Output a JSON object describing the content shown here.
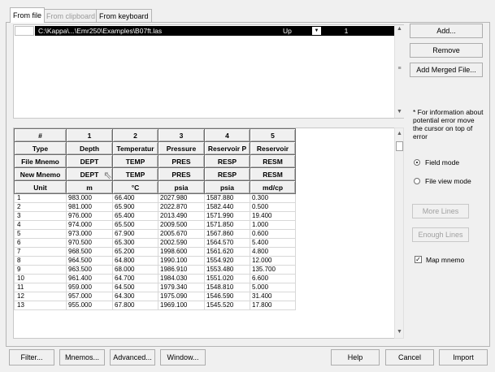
{
  "tabs": [
    "From file",
    "From clipboard",
    "From keyboard"
  ],
  "file_row": {
    "path": "C:\\Kappa\\...\\Emr250\\Examples\\B07ft.las",
    "direction": "Up",
    "count": "1"
  },
  "right_buttons": {
    "add": "Add...",
    "remove": "Remove",
    "add_merged": "Add Merged File..."
  },
  "info_text": "* For information about potential error move the cursor on top of error",
  "modes": {
    "field_mode": "Field mode",
    "file_view_mode": "File view mode"
  },
  "lines_buttons": {
    "more": "More Lines",
    "enough": "Enough Lines"
  },
  "map_mnemo": {
    "label": "Map mnemo",
    "checked": true
  },
  "grid": {
    "header_labels": [
      "#",
      "Type",
      "File Mnemo",
      "New Mnemo",
      "Unit"
    ],
    "columns": [
      {
        "num": "1",
        "type": "Depth",
        "file_mnemo": "DEPT",
        "new_mnemo": "DEPT",
        "unit": "m"
      },
      {
        "num": "2",
        "type": "Temperatur",
        "file_mnemo": "TEMP",
        "new_mnemo": "TEMP",
        "unit": "°C"
      },
      {
        "num": "3",
        "type": "Pressure",
        "file_mnemo": "PRES",
        "new_mnemo": "PRES",
        "unit": "psia"
      },
      {
        "num": "4",
        "type": "Reservoir P",
        "file_mnemo": "RESP",
        "new_mnemo": "RESP",
        "unit": "psia"
      },
      {
        "num": "5",
        "type": "Reservoir",
        "file_mnemo": "RESM",
        "new_mnemo": "RESM",
        "unit": "md/cp"
      }
    ],
    "rows": [
      {
        "n": "1",
        "v": [
          "983.000",
          "66.400",
          "2027.980",
          "1587.880",
          "0.300"
        ]
      },
      {
        "n": "2",
        "v": [
          "981.000",
          "65.900",
          "2022.870",
          "1582.440",
          "0.500"
        ]
      },
      {
        "n": "3",
        "v": [
          "976.000",
          "65.400",
          "2013.490",
          "1571.990",
          "19.400"
        ]
      },
      {
        "n": "4",
        "v": [
          "974.000",
          "65.500",
          "2009.500",
          "1571.850",
          "1.000"
        ]
      },
      {
        "n": "5",
        "v": [
          "973.000",
          "67.900",
          "2005.670",
          "1567.860",
          "0.600"
        ]
      },
      {
        "n": "6",
        "v": [
          "970.500",
          "65.300",
          "2002.590",
          "1564.570",
          "5.400"
        ]
      },
      {
        "n": "7",
        "v": [
          "968.500",
          "65.200",
          "1998.600",
          "1561.620",
          "4.800"
        ]
      },
      {
        "n": "8",
        "v": [
          "964.500",
          "64.800",
          "1990.100",
          "1554.920",
          "12.000"
        ]
      },
      {
        "n": "9",
        "v": [
          "963.500",
          "68.000",
          "1986.910",
          "1553.480",
          "135.700"
        ]
      },
      {
        "n": "10",
        "v": [
          "961.400",
          "64.700",
          "1984.030",
          "1551.020",
          "6.600"
        ]
      },
      {
        "n": "11",
        "v": [
          "959.000",
          "64.500",
          "1979.340",
          "1548.810",
          "5.000"
        ]
      },
      {
        "n": "12",
        "v": [
          "957.000",
          "64.300",
          "1975.090",
          "1546.590",
          "31.400"
        ]
      },
      {
        "n": "13",
        "v": [
          "955.000",
          "67.800",
          "1969.100",
          "1545.520",
          "17.800"
        ]
      }
    ]
  },
  "bottom_buttons": {
    "filter": "Filter...",
    "mnemos": "Mnemos...",
    "advanced": "Advanced...",
    "window": "Window...",
    "help": "Help",
    "cancel": "Cancel",
    "import": "Import"
  },
  "icons": {
    "dropdown": "dropdown-arrow-icon",
    "cursor": "mouse-cursor-icon",
    "scroll_up": "scroll-up-icon",
    "scroll_down": "scroll-down-icon"
  }
}
